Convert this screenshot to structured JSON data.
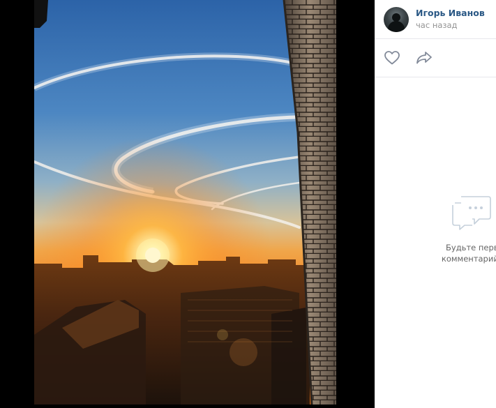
{
  "author": {
    "name": "Игорь Иванов",
    "time": "час назад"
  },
  "actions": {
    "like_icon": "heart-icon",
    "share_icon": "share-arrow-icon"
  },
  "comments": {
    "empty_icon": "chat-bubbles-icon",
    "empty_line1": "Будьте первым, кто о",
    "empty_line2": "комментарий к этой фо"
  }
}
